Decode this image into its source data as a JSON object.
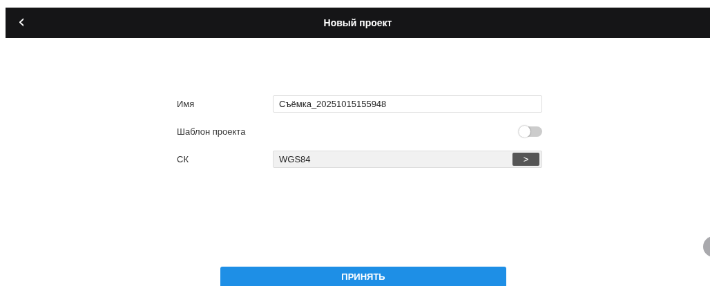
{
  "header": {
    "back_icon": "‹",
    "title": "Новый проект"
  },
  "form": {
    "name": {
      "label": "Имя",
      "value": "Съёмка_20251015155948"
    },
    "template": {
      "label": "Шаблон проекта",
      "on": false
    },
    "crs": {
      "label": "СК",
      "value": "WGS84",
      "button": ">"
    }
  },
  "accept_button": "ПРИНЯТЬ"
}
